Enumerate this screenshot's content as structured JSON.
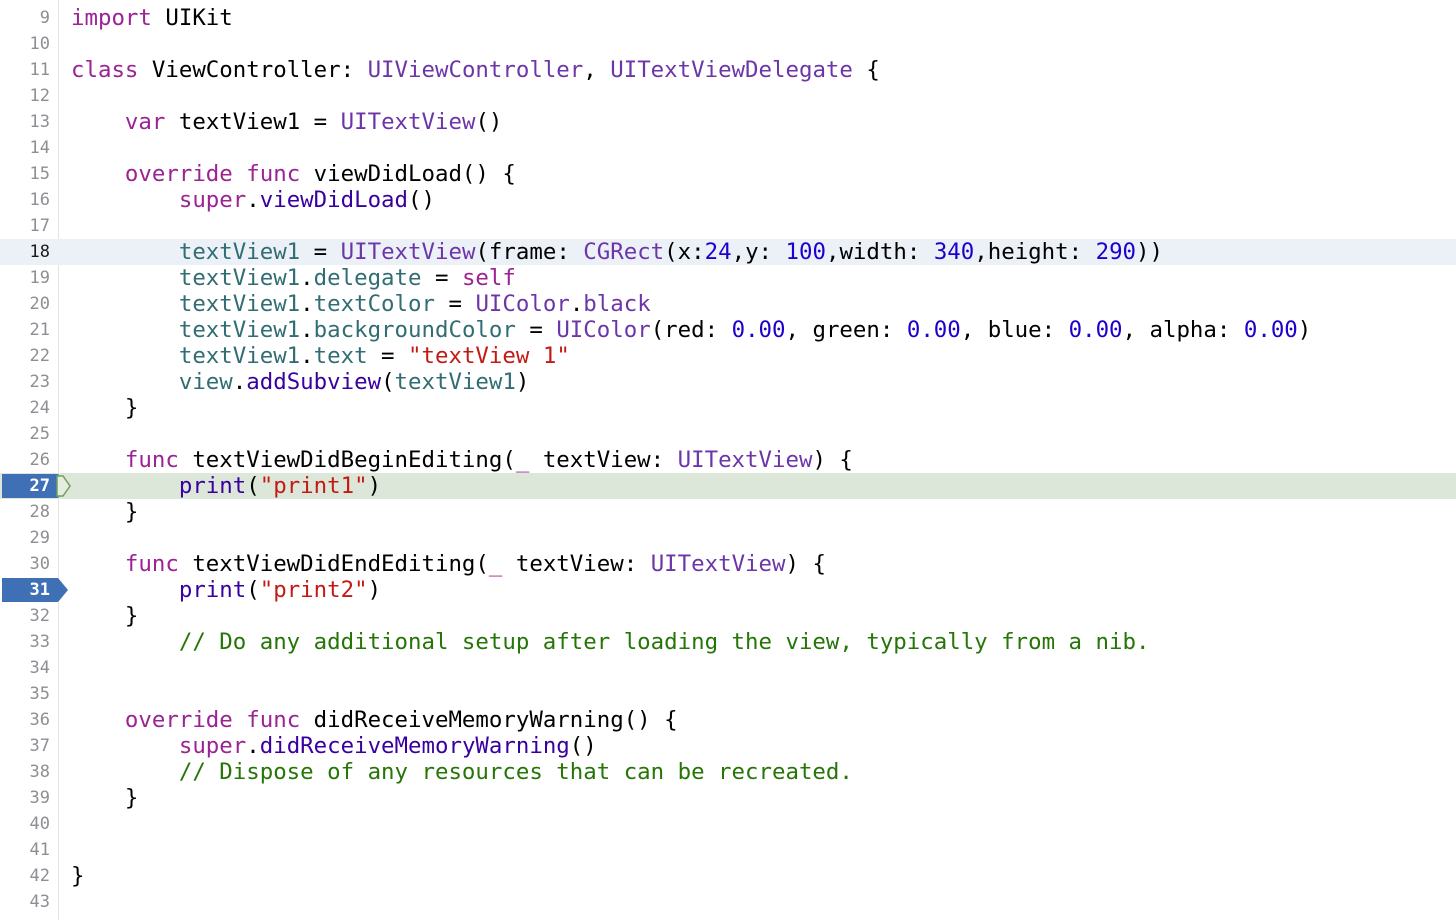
{
  "editor": {
    "language": "swift",
    "current_line": 18,
    "paused_line": 27,
    "breakpoint_lines": [
      27,
      31
    ],
    "colors": {
      "keyword": "#9b2393",
      "type": "#6c36a9",
      "property": "#326d74",
      "number": "#1c00cf",
      "string": "#c41a16",
      "comment": "#267507",
      "breakpoint": "#3f6fb5",
      "paused_line_bg": "#dce7d9",
      "current_line_bg": "#ecf1f8"
    },
    "lines": [
      {
        "n": "9",
        "tokens": [
          [
            "kw",
            "import"
          ],
          [
            "pl",
            " UIKit"
          ]
        ]
      },
      {
        "n": "10",
        "tokens": []
      },
      {
        "n": "11",
        "tokens": [
          [
            "kw",
            "class"
          ],
          [
            "pl",
            " ViewController: "
          ],
          [
            "ty",
            "UIViewController"
          ],
          [
            "pl",
            ", "
          ],
          [
            "ty",
            "UITextViewDelegate"
          ],
          [
            "pl",
            " {"
          ]
        ]
      },
      {
        "n": "12",
        "tokens": []
      },
      {
        "n": "13",
        "tokens": [
          [
            "pl",
            "    "
          ],
          [
            "kw",
            "var"
          ],
          [
            "pl",
            " textView1 = "
          ],
          [
            "ty",
            "UITextView"
          ],
          [
            "pl",
            "()"
          ]
        ]
      },
      {
        "n": "14",
        "tokens": []
      },
      {
        "n": "15",
        "tokens": [
          [
            "pl",
            "    "
          ],
          [
            "kw",
            "override"
          ],
          [
            "pl",
            " "
          ],
          [
            "kw",
            "func"
          ],
          [
            "pl",
            " viewDidLoad() {"
          ]
        ]
      },
      {
        "n": "16",
        "tokens": [
          [
            "pl",
            "        "
          ],
          [
            "kw",
            "super"
          ],
          [
            "pl",
            "."
          ],
          [
            "fn",
            "viewDidLoad"
          ],
          [
            "pl",
            "()"
          ]
        ]
      },
      {
        "n": "17",
        "tokens": []
      },
      {
        "n": "18",
        "tokens": [
          [
            "pl",
            "        "
          ],
          [
            "pr",
            "textView1"
          ],
          [
            "pl",
            " = "
          ],
          [
            "ty",
            "UITextView"
          ],
          [
            "pl",
            "(frame: "
          ],
          [
            "ty",
            "CGRect"
          ],
          [
            "pl",
            "(x:"
          ],
          [
            "num",
            "24"
          ],
          [
            "pl",
            ",y: "
          ],
          [
            "num",
            "100"
          ],
          [
            "pl",
            ",width: "
          ],
          [
            "num",
            "340"
          ],
          [
            "pl",
            ",height: "
          ],
          [
            "num",
            "290"
          ],
          [
            "pl",
            "))"
          ]
        ]
      },
      {
        "n": "19",
        "tokens": [
          [
            "pl",
            "        "
          ],
          [
            "pr",
            "textView1"
          ],
          [
            "pl",
            "."
          ],
          [
            "pr",
            "delegate"
          ],
          [
            "pl",
            " = "
          ],
          [
            "kw",
            "self"
          ]
        ]
      },
      {
        "n": "20",
        "tokens": [
          [
            "pl",
            "        "
          ],
          [
            "pr",
            "textView1"
          ],
          [
            "pl",
            "."
          ],
          [
            "pr",
            "textColor"
          ],
          [
            "pl",
            " = "
          ],
          [
            "ty",
            "UIColor"
          ],
          [
            "pl",
            "."
          ],
          [
            "ty",
            "black"
          ]
        ]
      },
      {
        "n": "21",
        "tokens": [
          [
            "pl",
            "        "
          ],
          [
            "pr",
            "textView1"
          ],
          [
            "pl",
            "."
          ],
          [
            "pr",
            "backgroundColor"
          ],
          [
            "pl",
            " = "
          ],
          [
            "ty",
            "UIColor"
          ],
          [
            "pl",
            "(red: "
          ],
          [
            "num",
            "0.00"
          ],
          [
            "pl",
            ", green: "
          ],
          [
            "num",
            "0.00"
          ],
          [
            "pl",
            ", blue: "
          ],
          [
            "num",
            "0.00"
          ],
          [
            "pl",
            ", alpha: "
          ],
          [
            "num",
            "0.00"
          ],
          [
            "pl",
            ")"
          ]
        ]
      },
      {
        "n": "22",
        "tokens": [
          [
            "pl",
            "        "
          ],
          [
            "pr",
            "textView1"
          ],
          [
            "pl",
            "."
          ],
          [
            "pr",
            "text"
          ],
          [
            "pl",
            " = "
          ],
          [
            "str",
            "\"textView 1\""
          ]
        ]
      },
      {
        "n": "23",
        "tokens": [
          [
            "pl",
            "        "
          ],
          [
            "pr",
            "view"
          ],
          [
            "pl",
            "."
          ],
          [
            "fn",
            "addSubview"
          ],
          [
            "pl",
            "("
          ],
          [
            "pr",
            "textView1"
          ],
          [
            "pl",
            ")"
          ]
        ]
      },
      {
        "n": "24",
        "tokens": [
          [
            "pl",
            "    }"
          ]
        ]
      },
      {
        "n": "25",
        "tokens": []
      },
      {
        "n": "26",
        "tokens": [
          [
            "pl",
            "    "
          ],
          [
            "kw",
            "func"
          ],
          [
            "pl",
            " textViewDidBeginEditing("
          ],
          [
            "kw",
            "_"
          ],
          [
            "pl",
            " textView: "
          ],
          [
            "ty",
            "UITextView"
          ],
          [
            "pl",
            ") {"
          ]
        ]
      },
      {
        "n": "27",
        "tokens": [
          [
            "pl",
            "        "
          ],
          [
            "fn",
            "print"
          ],
          [
            "pl",
            "("
          ],
          [
            "str",
            "\"print1\""
          ],
          [
            "pl",
            ")"
          ]
        ]
      },
      {
        "n": "28",
        "tokens": [
          [
            "pl",
            "    }"
          ]
        ]
      },
      {
        "n": "29",
        "tokens": []
      },
      {
        "n": "30",
        "tokens": [
          [
            "pl",
            "    "
          ],
          [
            "kw",
            "func"
          ],
          [
            "pl",
            " textViewDidEndEditing("
          ],
          [
            "kw",
            "_"
          ],
          [
            "pl",
            " textView: "
          ],
          [
            "ty",
            "UITextView"
          ],
          [
            "pl",
            ") {"
          ]
        ]
      },
      {
        "n": "31",
        "tokens": [
          [
            "pl",
            "        "
          ],
          [
            "fn",
            "print"
          ],
          [
            "pl",
            "("
          ],
          [
            "str",
            "\"print2\""
          ],
          [
            "pl",
            ")"
          ]
        ]
      },
      {
        "n": "32",
        "tokens": [
          [
            "pl",
            "    }"
          ]
        ]
      },
      {
        "n": "33",
        "tokens": [
          [
            "pl",
            "        "
          ],
          [
            "cm",
            "// Do any additional setup after loading the view, typically from a nib."
          ]
        ]
      },
      {
        "n": "34",
        "tokens": []
      },
      {
        "n": "35",
        "tokens": []
      },
      {
        "n": "36",
        "tokens": [
          [
            "pl",
            "    "
          ],
          [
            "kw",
            "override"
          ],
          [
            "pl",
            " "
          ],
          [
            "kw",
            "func"
          ],
          [
            "pl",
            " didReceiveMemoryWarning() {"
          ]
        ]
      },
      {
        "n": "37",
        "tokens": [
          [
            "pl",
            "        "
          ],
          [
            "kw",
            "super"
          ],
          [
            "pl",
            "."
          ],
          [
            "fn",
            "didReceiveMemoryWarning"
          ],
          [
            "pl",
            "()"
          ]
        ]
      },
      {
        "n": "38",
        "tokens": [
          [
            "pl",
            "        "
          ],
          [
            "cm",
            "// Dispose of any resources that can be recreated."
          ]
        ]
      },
      {
        "n": "39",
        "tokens": [
          [
            "pl",
            "    }"
          ]
        ]
      },
      {
        "n": "40",
        "tokens": []
      },
      {
        "n": "41",
        "tokens": []
      },
      {
        "n": "42",
        "tokens": [
          [
            "pl",
            "}"
          ]
        ]
      },
      {
        "n": "43",
        "tokens": []
      }
    ]
  }
}
